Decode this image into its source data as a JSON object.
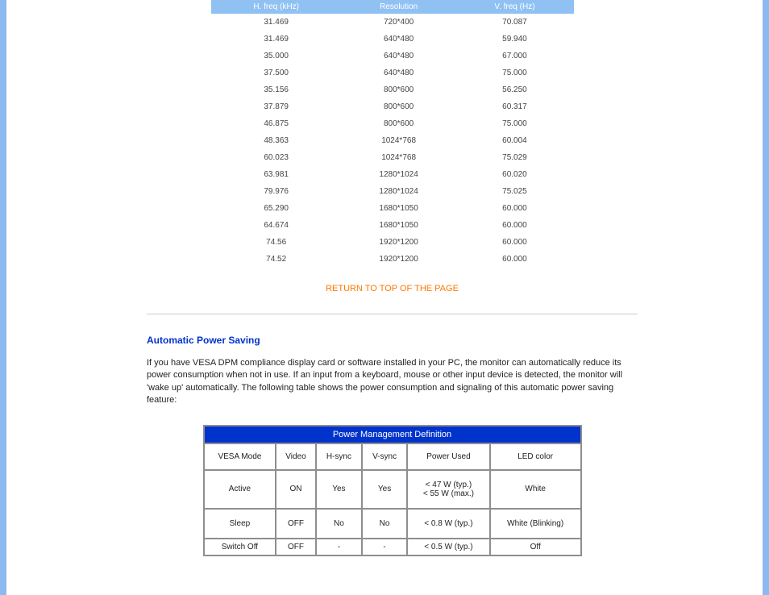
{
  "spec_table": {
    "headers": [
      "H. freq (kHz)",
      "Resolution",
      "V. freq (Hz)"
    ],
    "rows": [
      [
        "31.469",
        "720*400",
        "70.087"
      ],
      [
        "31.469",
        "640*480",
        "59.940"
      ],
      [
        "35.000",
        "640*480",
        "67.000"
      ],
      [
        "37.500",
        "640*480",
        "75.000"
      ],
      [
        "35.156",
        "800*600",
        "56.250"
      ],
      [
        "37.879",
        "800*600",
        "60.317"
      ],
      [
        "46.875",
        "800*600",
        "75.000"
      ],
      [
        "48.363",
        "1024*768",
        "60.004"
      ],
      [
        "60.023",
        "1024*768",
        "75.029"
      ],
      [
        "63.981",
        "1280*1024",
        "60.020"
      ],
      [
        "79.976",
        "1280*1024",
        "75.025"
      ],
      [
        "65.290",
        "1680*1050",
        "60.000"
      ],
      [
        "64.674",
        "1680*1050",
        "60.000"
      ],
      [
        "74.56",
        "1920*1200",
        "60.000"
      ],
      [
        "74.52",
        "1920*1200",
        "60.000"
      ]
    ]
  },
  "return_link": "RETURN TO TOP OF THE PAGE",
  "section": {
    "title": "Automatic Power Saving",
    "text": "If you have VESA DPM compliance display card or software installed in your PC, the monitor can automatically reduce its power consumption when not in use. If an input from a keyboard, mouse or other input device is detected, the monitor will 'wake up' automatically. The following table shows the power consumption and signaling of this automatic power saving feature:"
  },
  "power_table": {
    "title": "Power Management Definition",
    "headers": [
      "VESA Mode",
      "Video",
      "H-sync",
      "V-sync",
      "Power Used",
      "LED color"
    ],
    "rows": [
      {
        "cells": [
          "Active",
          "ON",
          "Yes",
          "Yes",
          "< 47 W (typ.)\n< 55 W (max.)",
          "White"
        ],
        "last": false
      },
      {
        "cells": [
          "Sleep",
          "OFF",
          "No",
          "No",
          "< 0.8 W (typ.)",
          "White (Blinking)"
        ],
        "last": false
      },
      {
        "cells": [
          "Switch Off",
          "OFF",
          "-",
          "-",
          "< 0.5 W (typ.)",
          "Off"
        ],
        "last": true
      }
    ]
  },
  "chart_data": [
    {
      "type": "table",
      "title": "Display Timing Modes",
      "columns": [
        "H. freq (kHz)",
        "Resolution",
        "V. freq (Hz)"
      ],
      "rows": [
        [
          31.469,
          "720*400",
          70.087
        ],
        [
          31.469,
          "640*480",
          59.94
        ],
        [
          35.0,
          "640*480",
          67.0
        ],
        [
          37.5,
          "640*480",
          75.0
        ],
        [
          35.156,
          "800*600",
          56.25
        ],
        [
          37.879,
          "800*600",
          60.317
        ],
        [
          46.875,
          "800*600",
          75.0
        ],
        [
          48.363,
          "1024*768",
          60.004
        ],
        [
          60.023,
          "1024*768",
          75.029
        ],
        [
          63.981,
          "1280*1024",
          60.02
        ],
        [
          79.976,
          "1280*1024",
          75.025
        ],
        [
          65.29,
          "1680*1050",
          60.0
        ],
        [
          64.674,
          "1680*1050",
          60.0
        ],
        [
          74.56,
          "1920*1200",
          60.0
        ],
        [
          74.52,
          "1920*1200",
          60.0
        ]
      ]
    },
    {
      "type": "table",
      "title": "Power Management Definition",
      "columns": [
        "VESA Mode",
        "Video",
        "H-sync",
        "V-sync",
        "Power Used",
        "LED color"
      ],
      "rows": [
        [
          "Active",
          "ON",
          "Yes",
          "Yes",
          "< 47 W (typ.) / < 55 W (max.)",
          "White"
        ],
        [
          "Sleep",
          "OFF",
          "No",
          "No",
          "< 0.8 W (typ.)",
          "White (Blinking)"
        ],
        [
          "Switch Off",
          "OFF",
          "-",
          "-",
          "< 0.5 W (typ.)",
          "Off"
        ]
      ]
    }
  ]
}
